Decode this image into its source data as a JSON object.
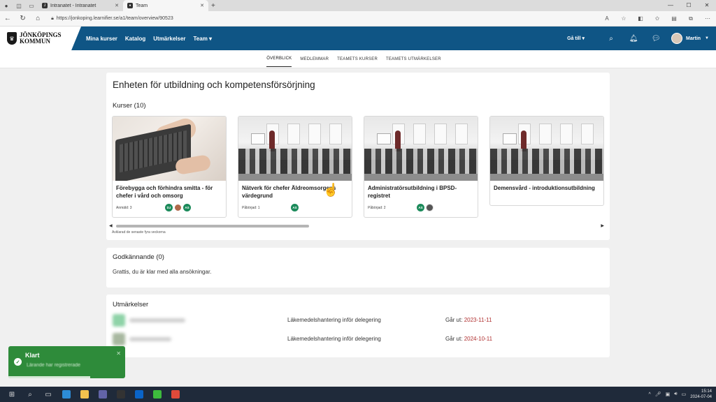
{
  "browser": {
    "tabs": [
      {
        "label": "Intranatet - Intranatet"
      },
      {
        "label": "Team"
      }
    ],
    "url": "https://jonkoping.learnifier.se/a1/team/overview/90523"
  },
  "header": {
    "logo_line1": "JÖNKÖPINGS",
    "logo_line2": "KOMMUN",
    "nav": [
      "Mina kurser",
      "Katalog",
      "Utmärkelser",
      "Team ▾"
    ],
    "goto_label": "Gå till ▾",
    "user_name": "Martin"
  },
  "subnav": [
    "ÖVERBLICK",
    "MEDLEMMAR",
    "TEAMETS KURSER",
    "TEAMETS UTMÄRKELSER"
  ],
  "unit": {
    "title": "Enheten för utbildning och kompetensförsörjning"
  },
  "courses": {
    "title": "Kurser (10)",
    "items": [
      {
        "name": "Förebygga och förhindra smitta - för chefer i vård och omsorg",
        "meta": "Anmäld: 3",
        "badges": [
          "DJ",
          "",
          "AS"
        ]
      },
      {
        "name": "Nätverk för chefer Äldreomsorgens värdegrund",
        "meta": "Påbörjad: 1",
        "badges": [
          "AS"
        ]
      },
      {
        "name": "Administratörsutbildning i BPSD-registret",
        "meta": "Påbörjad: 2",
        "badges": [
          "AS",
          ""
        ]
      },
      {
        "name": "Demensvård - introduktionsutbildning",
        "meta": "",
        "badges": []
      }
    ],
    "scroll_fraction": 0.4,
    "activity_note": "Avklarad de senaste fyra veckorna"
  },
  "approvals": {
    "title": "Godkännande (0)",
    "text": "Grattis, du är klar med alla ansökningar."
  },
  "awards": {
    "title": "Utmärkelser",
    "rows": [
      {
        "name": "Läkemedelshantering inför delegering",
        "expires_label": "Går ut:",
        "expires": "2023-11-11"
      },
      {
        "name": "Läkemedelshantering inför delegering",
        "expires_label": "Går ut:",
        "expires": "2024-10-11"
      }
    ]
  },
  "toast": {
    "title": "Klart",
    "message": "Lärande har registrerade",
    "progress": 0.7
  },
  "taskbar": {
    "time": "15:14",
    "date": "2024-07-04"
  },
  "colors": {
    "header": "#0f5585",
    "badge": "#1b8a5a",
    "toast": "#2e8b3a",
    "expire_date": "#b03030"
  }
}
